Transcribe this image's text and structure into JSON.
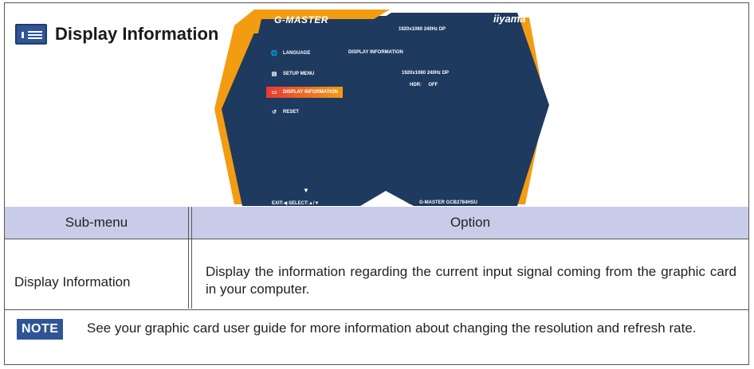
{
  "header": {
    "title": "Display Information",
    "icon": "display-info-icon",
    "accent_color": "#2f5597"
  },
  "osd": {
    "brand_left": "G-MASTER",
    "brand_right": "iiyama",
    "top_resolution": "1920x1080 240Hz DP",
    "menu": [
      {
        "label": "LANGUAGE",
        "icon": "globe-icon"
      },
      {
        "label": "SETUP MENU",
        "icon": "setup-menu-icon"
      },
      {
        "label": "DISPLAY INFORMATION",
        "icon": "display-info-icon",
        "selected": true
      },
      {
        "label": "RESET",
        "icon": "reset-icon"
      }
    ],
    "content_title": "DISPLAY INFORMATION",
    "content_resolution": "1920x1080 240Hz DP",
    "content_hdr": "HDR:     OFF",
    "bottom_left": "EXIT:◀  SELECT:▲/▼",
    "bottom_right": "G-MASTER GCB2784HSU",
    "colors": {
      "panel": "#1e3a5f",
      "frame": "#f39c12",
      "highlight": "#e53935"
    }
  },
  "table": {
    "headers": [
      "Sub-menu",
      "Option"
    ],
    "rows": [
      {
        "submenu": "Display Information",
        "option": "Display the information regarding the current input signal coming from the graphic card in your computer."
      }
    ],
    "header_bg": "#c9cce8"
  },
  "note": {
    "badge": "NOTE",
    "text": "See your graphic card user guide for more information about changing the resolution and refresh rate."
  }
}
